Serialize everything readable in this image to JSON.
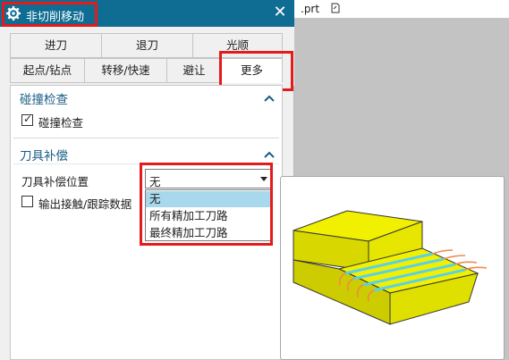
{
  "window": {
    "title": "非切削移动",
    "close_symbol": "✕"
  },
  "file": {
    "name": ".prt",
    "icon": "edit-file-icon"
  },
  "tabs": {
    "row1": [
      "进刀",
      "退刀",
      "光顺"
    ],
    "row2": [
      "起点/钻点",
      "转移/快速",
      "避让",
      "更多"
    ],
    "active": "更多"
  },
  "collision": {
    "title": "碰撞检查",
    "checkbox_label": "碰撞检查",
    "checked": true
  },
  "compensation": {
    "title": "刀具补偿",
    "position_label": "刀具补偿位置",
    "selected_value": "无",
    "options": [
      "无",
      "所有精加工刀路",
      "最终精加工刀路"
    ],
    "output_label": "输出接触/跟踪数据",
    "output_checked": false
  },
  "colors": {
    "title_bar": "#0f6c92",
    "accent_text": "#1a5d84",
    "highlight_box": "#e31b1b",
    "selected_option": "#a8d8ec",
    "part_yellow": "#f0f000",
    "toolpath_cyan": "#5ad0e8",
    "toolpath_orange": "#f08a4b"
  }
}
